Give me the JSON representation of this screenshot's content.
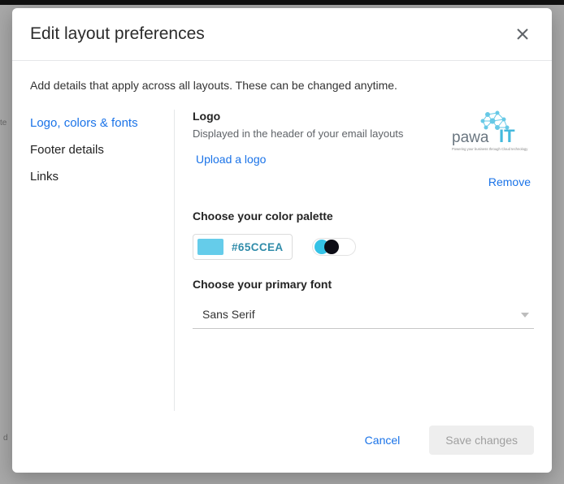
{
  "dialog": {
    "title": "Edit layout preferences",
    "intro": "Add details that apply across all layouts. These can be changed anytime."
  },
  "sidebar": {
    "items": [
      {
        "label": "Logo, colors & fonts",
        "active": true
      },
      {
        "label": "Footer details",
        "active": false
      },
      {
        "label": "Links",
        "active": false
      }
    ]
  },
  "logo": {
    "section_title": "Logo",
    "description": "Displayed in the header of your email layouts",
    "upload_label": "Upload a logo",
    "remove_label": "Remove",
    "brand_text_main": "pawa",
    "brand_text_accent": "IT",
    "brand_tagline": "Powering your business through Cloud technology"
  },
  "palette": {
    "section_title": "Choose your color palette",
    "hex": "#65CCEA"
  },
  "font": {
    "section_title": "Choose your primary font",
    "value": "Sans Serif"
  },
  "footer": {
    "cancel": "Cancel",
    "save": "Save changes"
  }
}
